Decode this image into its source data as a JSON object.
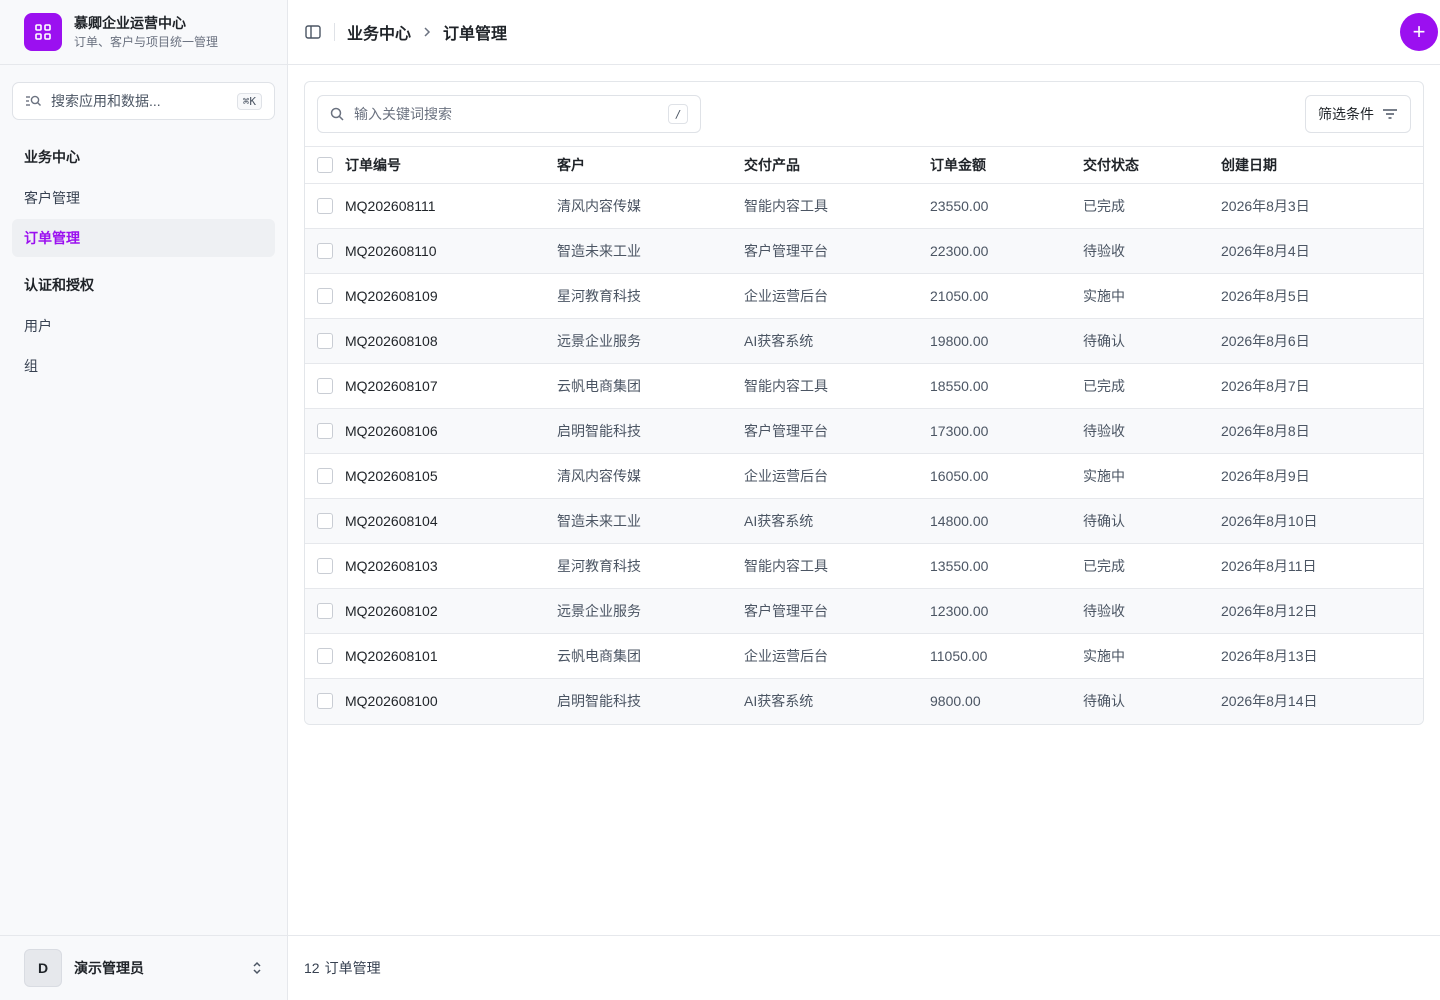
{
  "brand": {
    "name": "慕卿企业运营中心",
    "subtitle": "订单、客户与项目统一管理",
    "logo_icon": "grid-apps-icon",
    "accent": "#9b10f0"
  },
  "sidebar": {
    "search_placeholder": "搜索应用和数据...",
    "search_shortcut": "⌘K",
    "groups": [
      {
        "title": "业务中心",
        "items": [
          {
            "label": "客户管理",
            "active": false
          },
          {
            "label": "订单管理",
            "active": true
          }
        ]
      },
      {
        "title": "认证和授权",
        "items": [
          {
            "label": "用户",
            "active": false
          },
          {
            "label": "组",
            "active": false
          }
        ]
      }
    ],
    "user": {
      "avatar": "D",
      "name": "演示管理员"
    }
  },
  "header": {
    "breadcrumb": [
      "业务中心",
      "订单管理"
    ],
    "add_label": "+"
  },
  "toolbar": {
    "search_placeholder": "输入关键词搜索",
    "search_shortcut": "/",
    "filter_label": "筛选条件"
  },
  "table": {
    "columns": [
      "订单编号",
      "客户",
      "交付产品",
      "订单金额",
      "交付状态",
      "创建日期"
    ],
    "rows": [
      [
        "MQ202608111",
        "清风内容传媒",
        "智能内容工具",
        "23550.00",
        "已完成",
        "2026年8月3日"
      ],
      [
        "MQ202608110",
        "智造未来工业",
        "客户管理平台",
        "22300.00",
        "待验收",
        "2026年8月4日"
      ],
      [
        "MQ202608109",
        "星河教育科技",
        "企业运营后台",
        "21050.00",
        "实施中",
        "2026年8月5日"
      ],
      [
        "MQ202608108",
        "远景企业服务",
        "AI获客系统",
        "19800.00",
        "待确认",
        "2026年8月6日"
      ],
      [
        "MQ202608107",
        "云帆电商集团",
        "智能内容工具",
        "18550.00",
        "已完成",
        "2026年8月7日"
      ],
      [
        "MQ202608106",
        "启明智能科技",
        "客户管理平台",
        "17300.00",
        "待验收",
        "2026年8月8日"
      ],
      [
        "MQ202608105",
        "清风内容传媒",
        "企业运营后台",
        "16050.00",
        "实施中",
        "2026年8月9日"
      ],
      [
        "MQ202608104",
        "智造未来工业",
        "AI获客系统",
        "14800.00",
        "待确认",
        "2026年8月10日"
      ],
      [
        "MQ202608103",
        "星河教育科技",
        "智能内容工具",
        "13550.00",
        "已完成",
        "2026年8月11日"
      ],
      [
        "MQ202608102",
        "远景企业服务",
        "客户管理平台",
        "12300.00",
        "待验收",
        "2026年8月12日"
      ],
      [
        "MQ202608101",
        "云帆电商集团",
        "企业运营后台",
        "11050.00",
        "实施中",
        "2026年8月13日"
      ],
      [
        "MQ202608100",
        "启明智能科技",
        "AI获客系统",
        "9800.00",
        "待确认",
        "2026年8月14日"
      ]
    ]
  },
  "footer": {
    "count": "12",
    "label": "订单管理"
  }
}
